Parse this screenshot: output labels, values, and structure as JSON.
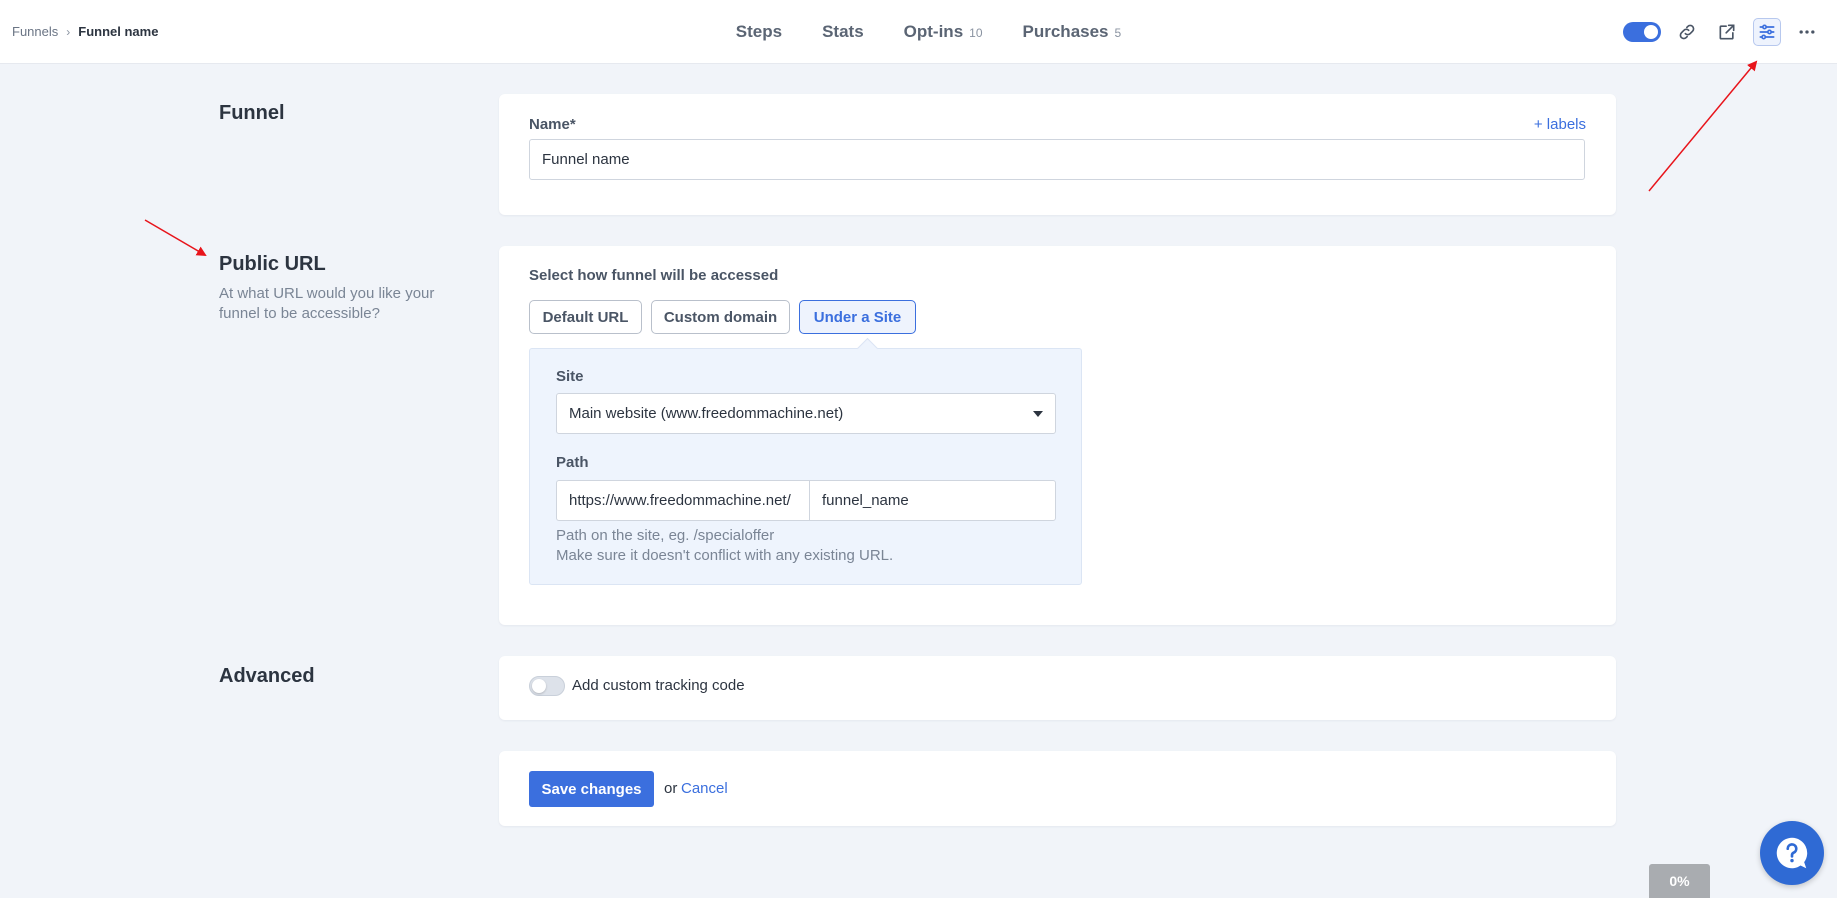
{
  "breadcrumb": {
    "parent": "Funnels",
    "current": "Funnel name"
  },
  "tabs": [
    {
      "label": "Steps",
      "count": ""
    },
    {
      "label": "Stats",
      "count": ""
    },
    {
      "label": "Opt-ins",
      "count": "10"
    },
    {
      "label": "Purchases",
      "count": "5"
    }
  ],
  "toolbar": {
    "publish_toggle": "on",
    "icons": [
      "link-icon",
      "external-link-icon",
      "settings-sliders-icon",
      "more-icon"
    ]
  },
  "funnel_section": {
    "title": "Funnel",
    "name_label": "Name*",
    "labels_link": "+ labels",
    "name_value": "Funnel name"
  },
  "public_url_section": {
    "title": "Public URL",
    "description": "At what URL would you like your funnel to be accessible?",
    "access_label": "Select how funnel will be accessed",
    "options": [
      "Default URL",
      "Custom domain",
      "Under a Site"
    ],
    "selected_option": "Under a Site",
    "site_label": "Site",
    "site_value": "Main website (www.freedommachine.net)",
    "path_label": "Path",
    "path_prefix": "https://www.freedommachine.net/",
    "path_value": "funnel_name",
    "help_line1": "Path on the site, eg. /specialoffer",
    "help_line2": "Make sure it doesn't conflict with any existing URL."
  },
  "advanced_section": {
    "title": "Advanced",
    "tracking_label": "Add custom tracking code",
    "tracking_enabled": false
  },
  "actions": {
    "save_label": "Save changes",
    "or_text": "or",
    "cancel_label": "Cancel"
  },
  "progress_badge": "0%",
  "colors": {
    "accent": "#3b6fde",
    "annotation": "#e8141b",
    "background": "#f1f4f9"
  }
}
